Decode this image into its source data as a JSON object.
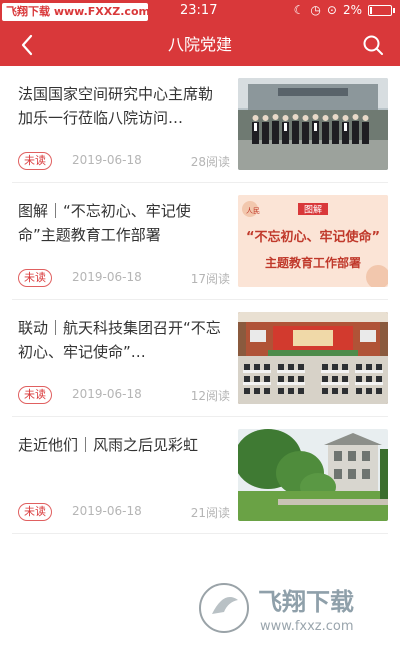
{
  "status_bar": {
    "watermark": "飞翔下载 www.FXXZ.com",
    "time": "23:17",
    "battery": "2%"
  },
  "nav": {
    "title": "八院党建"
  },
  "articles": [
    {
      "title": "法国国家空间研究中心主席勒加乐一行莅临八院访问…",
      "badge": "未读",
      "date": "2019-06-18",
      "reads": "28阅读",
      "thumb_alt": "group-photo"
    },
    {
      "title": "图解｜“不忘初心、牢记使命”主题教育工作部署",
      "badge": "未读",
      "date": "2019-06-18",
      "reads": "17阅读",
      "thumb_label_small": "图解",
      "thumb_label_main": "“不忘初心、牢记使命”",
      "thumb_label_sub": "主题教育工作部署"
    },
    {
      "title": "联动｜航天科技集团召开“不忘初心、牢记使命”…",
      "badge": "未读",
      "date": "2019-06-18",
      "reads": "12阅读",
      "thumb_alt": "conference-hall"
    },
    {
      "title": "走近他们｜风雨之后见彩虹",
      "badge": "未读",
      "date": "2019-06-18",
      "reads": "21阅读",
      "thumb_alt": "building-with-trees"
    }
  ],
  "watermark_bottom": {
    "brand": "飞翔下载",
    "url": "www.fxxz.com"
  },
  "colors": {
    "primary": "#d9383a",
    "muted": "#b5b5b5"
  }
}
